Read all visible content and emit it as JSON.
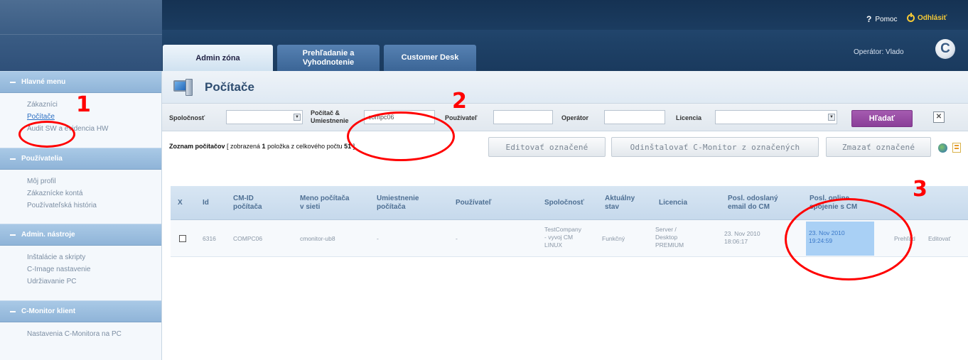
{
  "header": {
    "help_label": "Pomoc",
    "logout_label": "Odhlásiť",
    "operator_text": "Operátor: Vlado",
    "brand_letter": "C",
    "tabs": [
      {
        "label_line1": "Admin zóna",
        "label_line2": ""
      },
      {
        "label_line1": "Prehľadanie a",
        "label_line2": "Vyhodnotenie"
      },
      {
        "label_line1": "Customer Desk",
        "label_line2": ""
      }
    ]
  },
  "sidebar": {
    "sections": [
      {
        "title": "Hlavné menu",
        "items": [
          "Zákazníci",
          "Počítače",
          "Audit SW a evidencia HW"
        ]
      },
      {
        "title": "Používatelia",
        "items": [
          "Môj profil",
          "Zákaznícke kontá",
          "Používateľská história"
        ]
      },
      {
        "title": "Admin. nástroje",
        "items": [
          "Inštalácie a skripty",
          "C-Image nastavenie",
          "Udržiavanie PC"
        ]
      },
      {
        "title": "C-Monitor klient",
        "items": [
          "Nastavenia C-Monitora na PC"
        ]
      }
    ],
    "active_item": "Počítače"
  },
  "page": {
    "title": "Počítače"
  },
  "filters": {
    "company_label": "Spoločnosť",
    "computer_label_line1": "Počítač &",
    "computer_label_line2": "Umiestnenie",
    "computer_value": "compc06",
    "user_label": "Používateľ",
    "operator_label": "Operátor",
    "license_label": "Licencia",
    "search_button": "Hľadať"
  },
  "list": {
    "title_bold": "Zoznam počítačov",
    "title_rest_a": " [ zobrazená ",
    "shown_count": "1",
    "title_rest_b": " položka z celkového počtu ",
    "total_count": "51",
    "title_rest_c": " ]",
    "edit_button": "Editovať označené",
    "uninstall_button": "Odinštalovať C-Monitor z označených",
    "delete_button": "Zmazať označené"
  },
  "table": {
    "headers": {
      "x": "X",
      "id": "Id",
      "cmid_1": "CM-ID",
      "cmid_2": "počítača",
      "name_1": "Meno počítača",
      "name_2": "v sieti",
      "loc_1": "Umiestnenie",
      "loc_2": "počítača",
      "user": "Používateľ",
      "company": "Spoločnosť",
      "status_1": "Aktuálny",
      "status_2": "stav",
      "license": "Licencia",
      "email_1": "Posl. odoslaný",
      "email_2": "email do CM",
      "conn_1": "Posl. online",
      "conn_2": "spojenie s CM"
    },
    "rows": [
      {
        "id": "6316",
        "cmid": "COMPC06",
        "name": "cmonitor-ub8",
        "location": "-",
        "user": "-",
        "company_1": "TestCompany",
        "company_2": "- vyvoj CM",
        "company_3": "LINUX",
        "status": "Funkčný",
        "license_1": "Server /",
        "license_2": "Desktop",
        "license_3": "PREMIUM",
        "email_1": "23. Nov 2010",
        "email_2": "18:06:17",
        "conn_1": "23. Nov 2010",
        "conn_2": "19:24:59",
        "action_view": "Prehľad",
        "action_edit": "Editovať"
      }
    ]
  },
  "annotations": [
    "1",
    "2",
    "3"
  ],
  "colors": {
    "accent_purple": "#8a3f98",
    "annotation_red": "#ff0000",
    "highlight_blue": "#a9d0f5"
  }
}
